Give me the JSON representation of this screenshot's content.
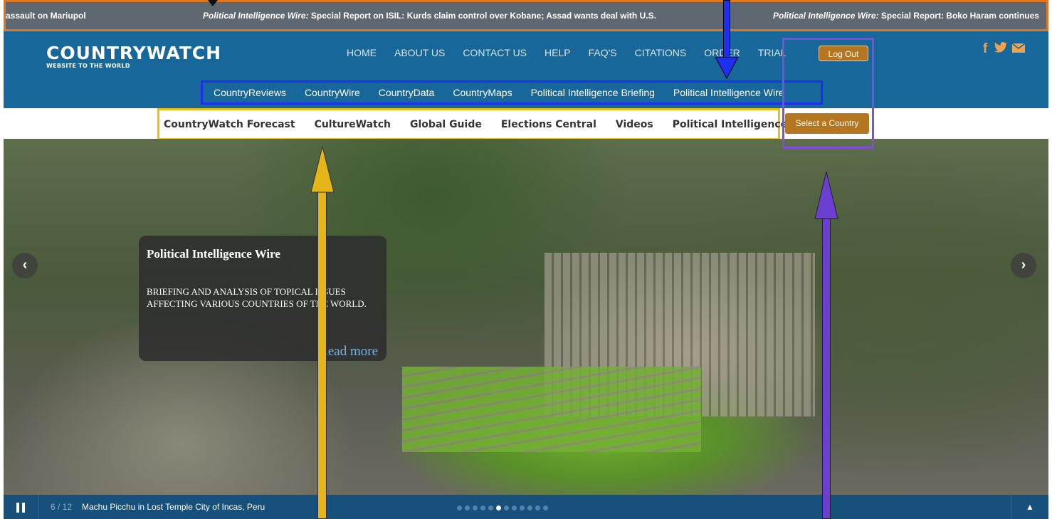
{
  "ticker": {
    "segments": [
      {
        "prefix": "",
        "text": "assault on Mariupol"
      },
      {
        "prefix": "Political Intelligence Wire:",
        "text": " Special Report on ISIL: Kurds claim control over Kobane; Assad wants deal with U.S."
      },
      {
        "prefix": "Political Intelligence Wire:",
        "text": " Special Report: Boko Haram continues"
      }
    ]
  },
  "logo": {
    "main": "COUNTRYWATCH",
    "tagline": "WEBSITE TO THE WORLD"
  },
  "top_nav": [
    "HOME",
    "ABOUT US",
    "CONTACT US",
    "HELP",
    "FAQ'S",
    "CITATIONS",
    "ORDER",
    "TRIAL"
  ],
  "logout_label": "Log Out",
  "social": {
    "facebook": "f",
    "twitter": "t-icon",
    "email": "mail-icon"
  },
  "sub_nav": [
    "CountryReviews",
    "CountryWire",
    "CountryData",
    "CountryMaps",
    "Political Intelligence Briefing",
    "Political Intelligence Wire"
  ],
  "tools_nav": [
    "CountryWatch Forecast",
    "CultureWatch",
    "Global Guide",
    "Elections Central",
    "Videos",
    "Political Intelligence Zone"
  ],
  "select_country_label": "Select a Country",
  "hero": {
    "caption_title": "Political Intelligence Wire",
    "caption_desc": "BRIEFING AND ANALYSIS OF TOPICAL ISSUES AFFECTING VARIOUS COUNTRIES OF THE WORLD.",
    "read_more": "Read more",
    "prev": "‹",
    "next": "›"
  },
  "slider": {
    "counter": "6 / 12",
    "title": "Machu Picchu in Lost Temple City of Incas, Peru",
    "total": 12,
    "current": 6,
    "up": "▲"
  },
  "colors": {
    "header": "#17679b",
    "button": "#b5761f",
    "ticker_border": "#e0761e",
    "sub_nav_box": "#1d2ff0",
    "tools_box": "#f0c010",
    "purple_box": "#7d4fd8"
  }
}
